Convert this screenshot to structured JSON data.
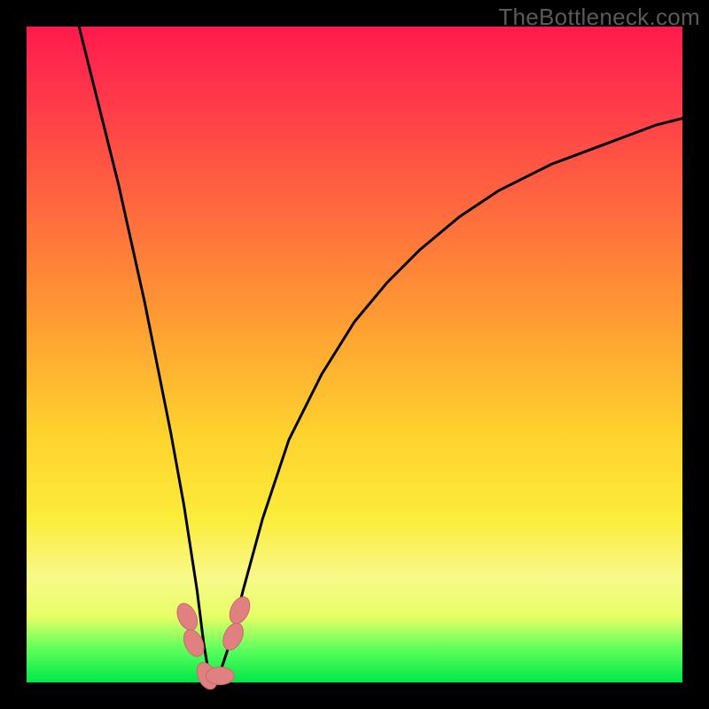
{
  "watermark": "TheBottleneck.com",
  "chart_data": {
    "type": "line",
    "title": "",
    "xlabel": "",
    "ylabel": "",
    "xlim": [
      0,
      100
    ],
    "ylim": [
      0,
      100
    ],
    "series": [
      {
        "name": "bottleneck-curve",
        "x": [
          8,
          10,
          12,
          14,
          16,
          18,
          20,
          22,
          24,
          26,
          27,
          28,
          29,
          31,
          33,
          36,
          40,
          45,
          50,
          55,
          60,
          66,
          72,
          80,
          88,
          96,
          100
        ],
        "values": [
          100,
          92,
          84,
          76,
          67,
          58,
          48,
          38,
          27,
          14,
          6,
          0,
          0,
          6,
          14,
          25,
          37,
          47,
          55,
          61,
          66,
          71,
          75,
          79,
          82,
          85,
          86
        ]
      }
    ],
    "markers": [
      {
        "name": "marker-left-upper",
        "x": 24.5,
        "y": 10
      },
      {
        "name": "marker-left-lower",
        "x": 25.5,
        "y": 6
      },
      {
        "name": "marker-bottom-left",
        "x": 27.5,
        "y": 1
      },
      {
        "name": "marker-bottom-right",
        "x": 29.5,
        "y": 1
      },
      {
        "name": "marker-right-lower",
        "x": 31.5,
        "y": 7
      },
      {
        "name": "marker-right-upper",
        "x": 32.5,
        "y": 11
      }
    ],
    "gradient_scale": {
      "top_color": "#ff1a4d",
      "bottom_color": "#00e84a",
      "meaning": "high value (top) = bottleneck, low value (bottom) = balanced"
    }
  }
}
